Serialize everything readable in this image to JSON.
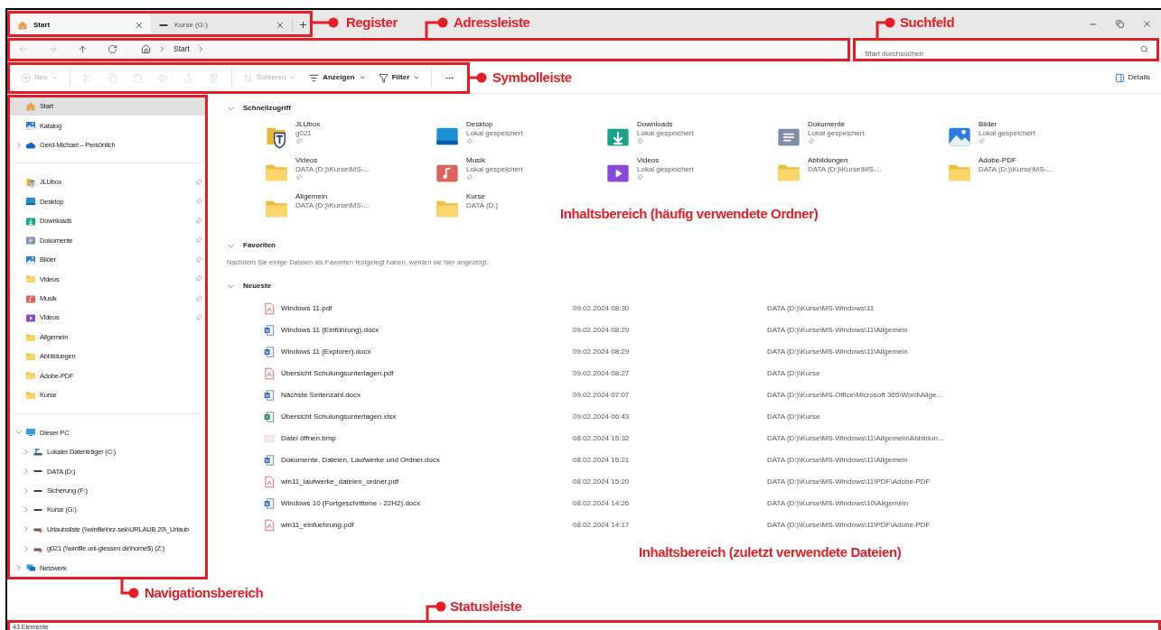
{
  "tabs": [
    {
      "label": "Start",
      "kind": "home",
      "selected": true
    },
    {
      "label": "Kurse (G:)",
      "kind": "drive",
      "selected": false
    }
  ],
  "nav_buttons": [
    {
      "kind": "back",
      "disabled": true
    },
    {
      "kind": "forward",
      "disabled": true
    },
    {
      "kind": "up",
      "disabled": false
    },
    {
      "kind": "refresh",
      "disabled": false
    }
  ],
  "breadcrumb": [
    "Start"
  ],
  "search": {
    "placeholder": "Start durchsuchen"
  },
  "toolbar": {
    "items": [
      {
        "kind": "new",
        "label": "Neu",
        "disabled": true
      },
      {
        "kind": "separator"
      },
      {
        "kind": "cut",
        "disabled": true
      },
      {
        "kind": "copy",
        "disabled": true
      },
      {
        "kind": "paste",
        "disabled": true
      },
      {
        "kind": "rename",
        "disabled": true
      },
      {
        "kind": "share",
        "disabled": true
      },
      {
        "kind": "delete",
        "disabled": true
      },
      {
        "kind": "separator"
      },
      {
        "kind": "sort",
        "label": "Sortieren",
        "disabled": true
      },
      {
        "kind": "view",
        "label": "Anzeigen",
        "disabled": false
      },
      {
        "kind": "filter",
        "label": "Filter",
        "disabled": false
      },
      {
        "kind": "separator"
      },
      {
        "kind": "more",
        "disabled": false
      }
    ],
    "details": {
      "label": "Details"
    }
  },
  "sidebar": {
    "sections": [
      {
        "items": [
          {
            "label": "Start",
            "kind": "home",
            "selected": true
          },
          {
            "label": "Katalog",
            "kind": "gallery",
            "selected": false
          },
          {
            "label": "Gerd-Michael – Persönlich",
            "kind": "cloud",
            "selected": false,
            "expanded": false
          }
        ]
      },
      {
        "items": [
          {
            "label": "JLUbox",
            "kind": "jlubox",
            "selected": false,
            "pinned": true
          },
          {
            "label": "Desktop",
            "kind": "desktop",
            "selected": false,
            "pinned": true
          },
          {
            "label": "Downloads",
            "kind": "downloads",
            "selected": false,
            "pinned": true
          },
          {
            "label": "Dokumente",
            "kind": "documents",
            "selected": false,
            "pinned": true
          },
          {
            "label": "Bilder",
            "kind": "pictures",
            "selected": false,
            "pinned": true
          },
          {
            "label": "Videos",
            "kind": "folder",
            "selected": false,
            "pinned": true
          },
          {
            "label": "Musik",
            "kind": "music",
            "selected": false,
            "pinned": true
          },
          {
            "label": "Videos",
            "kind": "videos",
            "selected": false,
            "pinned": true
          },
          {
            "label": "Allgemein",
            "kind": "folder",
            "selected": false,
            "pinned": false
          },
          {
            "label": "Abbildungen",
            "kind": "folder",
            "selected": false,
            "pinned": false
          },
          {
            "label": "Adobe-PDF",
            "kind": "folder",
            "selected": false,
            "pinned": false
          },
          {
            "label": "Kurse",
            "kind": "folder",
            "selected": false,
            "pinned": false
          }
        ]
      },
      {
        "items": [
          {
            "label": "Dieser PC",
            "kind": "pc",
            "selected": false,
            "expanded": true,
            "children": [
              {
                "label": "Lokaler Datenträger (C:)",
                "kind": "system-drive",
                "selected": false,
                "expanded": false
              },
              {
                "label": "DATA (D:)",
                "kind": "drive",
                "selected": false,
                "expanded": false
              },
              {
                "label": "Sicherung (F:)",
                "kind": "drive",
                "selected": false,
                "expanded": false
              },
              {
                "label": "Kurse (G:)",
                "kind": "drive",
                "selected": false,
                "expanded": false
              },
              {
                "label": "Urlaubsliste (\\\\winfile\\hrz-sek\\URLAUB 20\\_Urlaub",
                "kind": "netdrive",
                "selected": false,
                "expanded": false
              },
              {
                "label": "g021 (\\\\winfile.uni-giessen.de\\home$) (Z:)",
                "kind": "netdrive",
                "selected": false,
                "expanded": false
              }
            ]
          },
          {
            "label": "Netzwerk",
            "kind": "network",
            "selected": false,
            "expanded": false
          }
        ]
      }
    ]
  },
  "quick_access": {
    "title": "Schnellzugriff",
    "expanded": true,
    "items": [
      {
        "name": "JLUbox",
        "detail": "g021",
        "kind": "jlubox",
        "pinned": true
      },
      {
        "name": "Desktop",
        "detail": "Lokal gespeichert",
        "kind": "desktop",
        "pinned": true
      },
      {
        "name": "Downloads",
        "detail": "Lokal gespeichert",
        "kind": "downloads",
        "pinned": true
      },
      {
        "name": "Dokumente",
        "detail": "Lokal gespeichert",
        "kind": "documents",
        "pinned": true
      },
      {
        "name": "Bilder",
        "detail": "Lokal gespeichert",
        "kind": "pictures",
        "pinned": true
      },
      {
        "name": "Videos",
        "detail": "DATA (D:)\\Kurse\\MS-...",
        "kind": "folder",
        "pinned": true
      },
      {
        "name": "Musik",
        "detail": "Lokal gespeichert",
        "kind": "music",
        "pinned": true
      },
      {
        "name": "Videos",
        "detail": "Lokal gespeichert",
        "kind": "videos",
        "pinned": true
      },
      {
        "name": "Abbildungen",
        "detail": "DATA (D:)\\Kurse\\MS-...",
        "kind": "folder",
        "pinned": false
      },
      {
        "name": "Adobe-PDF",
        "detail": "DATA (D:)\\Kurse\\MS-...",
        "kind": "folder",
        "pinned": false
      },
      {
        "name": "Allgemein",
        "detail": "DATA (D:)\\Kurse\\MS-...",
        "kind": "folder",
        "pinned": false
      },
      {
        "name": "Kurse",
        "detail": "DATA (D:)",
        "kind": "folder",
        "pinned": false
      }
    ]
  },
  "favorites": {
    "title": "Favoriten",
    "expanded": true,
    "message": "Nachdem Sie einige Dateien als Favoriten festgelegt haben, werden sie hier angezeigt."
  },
  "recent": {
    "title": "Neueste",
    "expanded": true,
    "files": [
      {
        "name": "Windows 11.pdf",
        "date": "09.02.2024 08:30",
        "path": "DATA (D:)\\Kurse\\MS-Windows\\11",
        "kind": "pdf"
      },
      {
        "name": "Windows 11 (Einführung).docx",
        "date": "09.02.2024 08:29",
        "path": "DATA (D:)\\Kurse\\MS-Windows\\11\\Allgemein",
        "kind": "word"
      },
      {
        "name": "Windows 11 (Explorer).docx",
        "date": "09.02.2024 08:29",
        "path": "DATA (D:)\\Kurse\\MS-Windows\\11\\Allgemein",
        "kind": "word"
      },
      {
        "name": "Übersicht Schulungsunterlagen.pdf",
        "date": "09.02.2024 08:27",
        "path": "DATA (D:)\\Kurse",
        "kind": "pdf"
      },
      {
        "name": "Nächste Seitenzahl.docx",
        "date": "09.02.2024 07:07",
        "path": "DATA (D:)\\Kurse\\MS-Office\\Microsoft 365\\Word\\Allge...",
        "kind": "word"
      },
      {
        "name": "Übersicht Schulungsunterlagen.xlsx",
        "date": "09.02.2024 06:43",
        "path": "DATA (D:)\\Kurse",
        "kind": "excel"
      },
      {
        "name": "Datei öffnen.bmp",
        "date": "08.02.2024 15:32",
        "path": "DATA (D:)\\Kurse\\MS-Windows\\11\\Allgemein\\Abbildun...",
        "kind": "image"
      },
      {
        "name": "Dokumente, Dateien, Laufwerke und Ordner.docx",
        "date": "08.02.2024 15:21",
        "path": "DATA (D:)\\Kurse\\MS-Windows\\11\\Allgemein",
        "kind": "word"
      },
      {
        "name": "win11_laufwerke_dateien_ordner.pdf",
        "date": "08.02.2024 15:20",
        "path": "DATA (D:)\\Kurse\\MS-Windows\\11\\PDF\\Adobe-PDF",
        "kind": "pdf"
      },
      {
        "name": "Windows 10 (Fortgeschrittene - 22H2).docx",
        "date": "08.02.2024 14:26",
        "path": "DATA (D:)\\Kurse\\MS-Windows\\10\\Allgemein",
        "kind": "word"
      },
      {
        "name": "win11_einfuehrung.pdf",
        "date": "08.02.2024 14:17",
        "path": "DATA (D:)\\Kurse\\MS-Windows\\11\\PDF\\Adobe-PDF",
        "kind": "pdf"
      }
    ]
  },
  "status_bar": {
    "count": "43 Elemente"
  },
  "annotations": [
    {
      "label": "Register"
    },
    {
      "label": "Adressleiste"
    },
    {
      "label": "Suchfeld"
    },
    {
      "label": "Symbolleiste"
    },
    {
      "label": "Inhaltsbereich (häufig verwendete Ordner)"
    },
    {
      "label": "Navigationsbereich"
    },
    {
      "label": "Inhaltsbereich (zuletzt verwendete Dateien)"
    },
    {
      "label": "Statusleiste"
    }
  ]
}
